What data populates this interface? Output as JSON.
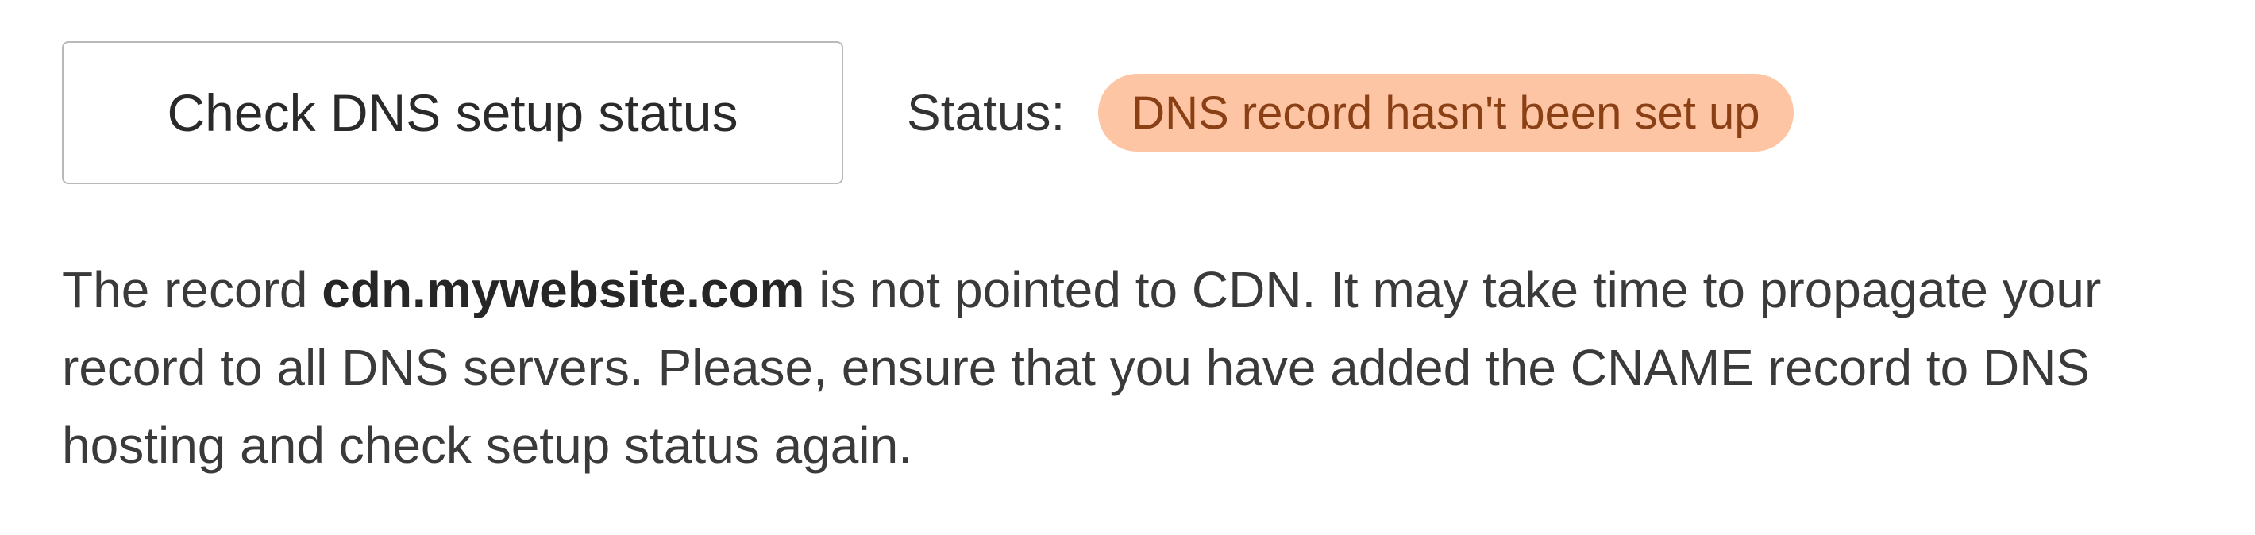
{
  "check_button": {
    "label": "Check DNS setup status"
  },
  "status": {
    "label": "Status:",
    "badge_text": "DNS record hasn't been set up",
    "badge_color": "#fdc5a3",
    "badge_text_color": "#8a3f14"
  },
  "message": {
    "prefix": "The record ",
    "domain": "cdn.mywebsite.com",
    "suffix": " is not pointed to CDN. It may take time to propagate your record to all DNS servers. Please, ensure that you have added the CNAME record to DNS hosting and check setup status again."
  }
}
